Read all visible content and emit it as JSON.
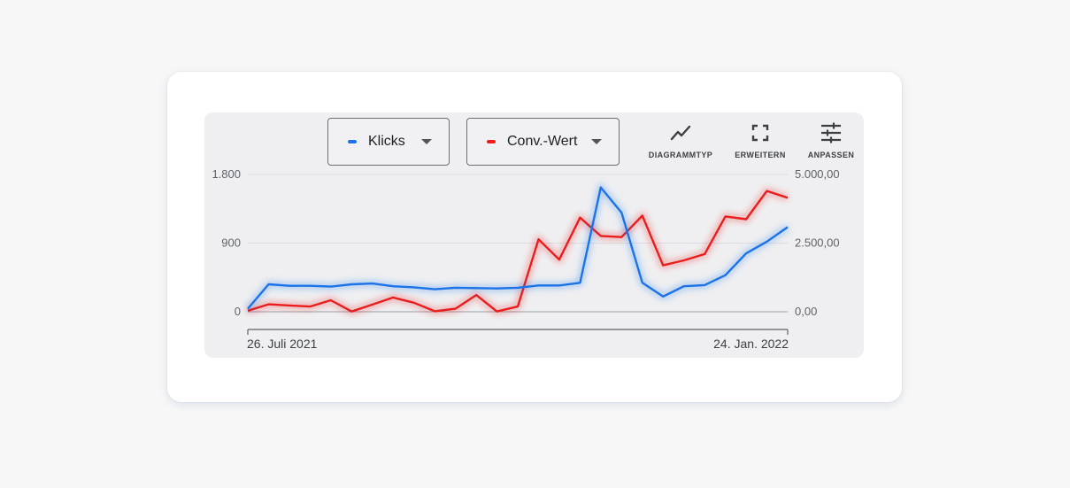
{
  "series_selectors": [
    {
      "label": "Klicks",
      "color": "#1a73e8"
    },
    {
      "label": "Conv.-Wert",
      "color": "#ea1d1d"
    }
  ],
  "toolbar": {
    "chart_type_label": "DIAGRAMMTYP",
    "expand_label": "ERWEITERN",
    "customize_label": "ANPASSEN"
  },
  "chart_data": {
    "type": "line",
    "x_start_label": "26. Juli 2021",
    "x_end_label": "24. Jan. 2022",
    "left_axis": {
      "ylim": [
        0,
        1800
      ],
      "ticks": [
        0,
        900,
        1800
      ],
      "tick_labels": [
        "0",
        "900",
        "1.800"
      ]
    },
    "right_axis": {
      "ylim": [
        0,
        5000
      ],
      "ticks": [
        0,
        2500,
        5000
      ],
      "tick_labels": [
        "0,00",
        "2.500,00",
        "5.000,00"
      ]
    },
    "grid": true,
    "series": [
      {
        "name": "Klicks",
        "axis": "left",
        "color": "#1a73e8",
        "values": [
          40,
          360,
          340,
          340,
          330,
          360,
          370,
          335,
          320,
          295,
          315,
          310,
          305,
          315,
          345,
          345,
          380,
          1630,
          1300,
          380,
          200,
          335,
          350,
          480,
          765,
          920,
          1110
        ]
      },
      {
        "name": "Conv.-Wert",
        "axis": "right",
        "color": "#ea1d1d",
        "values": [
          40,
          270,
          230,
          190,
          420,
          10,
          260,
          520,
          330,
          20,
          110,
          610,
          10,
          190,
          2640,
          1900,
          3430,
          2760,
          2720,
          3500,
          1690,
          1870,
          2100,
          3470,
          3370,
          4400,
          4150
        ]
      }
    ]
  }
}
